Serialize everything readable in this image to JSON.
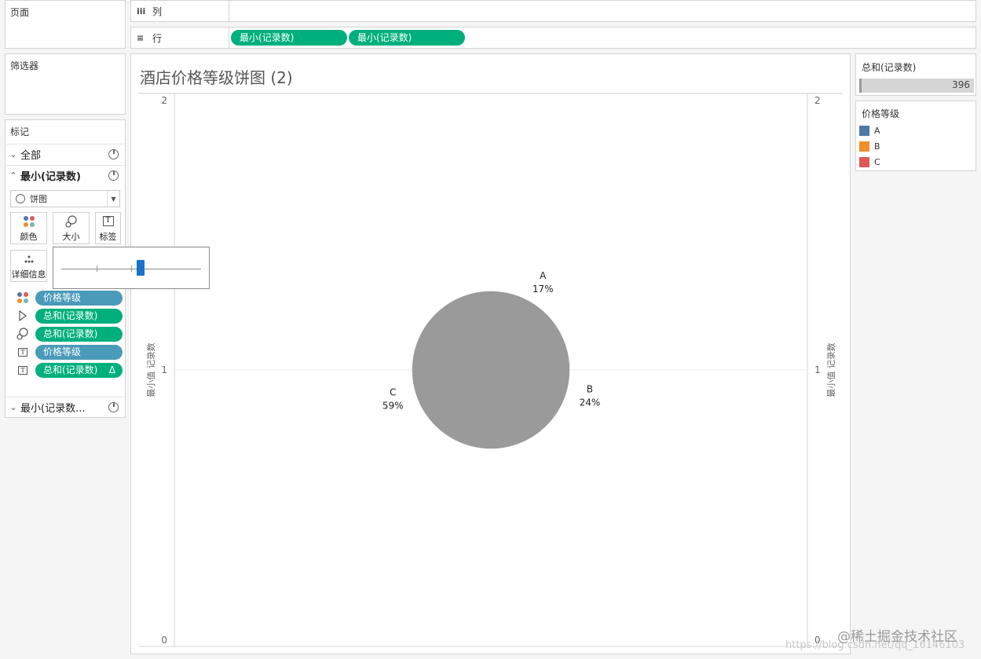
{
  "pages": {
    "title": "页面"
  },
  "filters": {
    "title": "筛选器"
  },
  "marks": {
    "title": "标记",
    "cards": [
      {
        "label": "全部"
      },
      {
        "label": "最小(记录数)"
      },
      {
        "label": "最小(记录数..."
      }
    ],
    "mark_type": "饼图",
    "buttons": {
      "color": "颜色",
      "size": "大小",
      "label": "标签",
      "detail": "详细信息"
    },
    "fields": [
      {
        "label": "价格等级",
        "kind": "dimension",
        "icon": "color-icon"
      },
      {
        "label": "总和(记录数)",
        "kind": "measure",
        "icon": "angle-icon"
      },
      {
        "label": "总和(记录数)",
        "kind": "measure",
        "icon": "size-icon"
      },
      {
        "label": "价格等级",
        "kind": "dimension",
        "icon": "label-icon"
      },
      {
        "label": "总和(记录数)",
        "kind": "measure",
        "icon": "label-icon",
        "suffix": "Δ"
      }
    ],
    "size_slider_value": 0.6
  },
  "columns_shelf": {
    "label": "列",
    "icon": "columns-icon",
    "pills": []
  },
  "rows_shelf": {
    "label": "行",
    "icon": "rows-icon",
    "pills": [
      "最小(记录数)",
      "最小(记录数)"
    ]
  },
  "view": {
    "title": "酒店价格等级饼图 (2)"
  },
  "sum_legend": {
    "title": "总和(记录数)",
    "value": "396"
  },
  "color_legend": {
    "title": "价格等级",
    "items": [
      {
        "label": "A",
        "color": "#4e79a7"
      },
      {
        "label": "B",
        "color": "#f28e2b"
      },
      {
        "label": "C",
        "color": "#e15759"
      }
    ]
  },
  "watermark": "@稀土掘金技术社区",
  "watermark2": "https://blog.csdn.net/qq_16146103",
  "chart_data": {
    "type": "pie",
    "title": "",
    "axis_label_left": "最小值 记录数",
    "axis_label_right": "最小值 记录数",
    "yticks": [
      "2",
      "1",
      "0"
    ],
    "ylim": [
      0,
      2
    ],
    "pie_fill": "#9a9a9a",
    "slices": [
      {
        "label": "A",
        "percent": "17%",
        "value": 17
      },
      {
        "label": "B",
        "percent": "24%",
        "value": 24
      },
      {
        "label": "C",
        "percent": "59%",
        "value": 59
      }
    ]
  }
}
